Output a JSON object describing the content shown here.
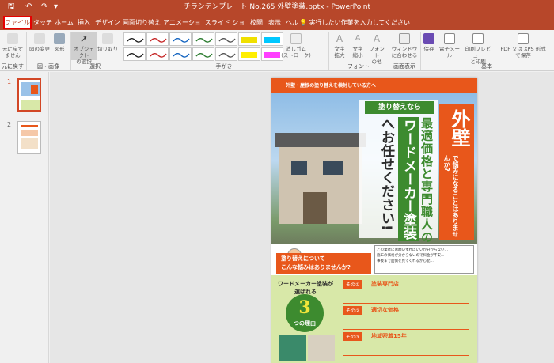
{
  "titlebar": {
    "title": "チラシテンプレート No.265 外壁塗装.pptx - PowerPoint"
  },
  "tabs": [
    {
      "label": "ファイル"
    },
    {
      "label": "タッチ"
    },
    {
      "label": "ホーム"
    },
    {
      "label": "挿入"
    },
    {
      "label": "デザイン"
    },
    {
      "label": "画面切り替え"
    },
    {
      "label": "アニメーション"
    },
    {
      "label": "スライド ショー"
    },
    {
      "label": "校閲"
    },
    {
      "label": "表示"
    },
    {
      "label": "ヘルプ"
    }
  ],
  "tell_me": "実行したい作業を入力してください",
  "ribbon": {
    "undo": "元に戻す\nません",
    "resize": "図の変更",
    "shapes": "図形",
    "object_select": "オブジェクト\nの選択",
    "lasso": "切り取り",
    "eraser": "消しゴム\n(ストローク)",
    "zoom_in": "文字\n拡大",
    "zoom_out": "文字\n縮小",
    "font_other": "フォント\nの他",
    "fit_window": "ウィンドウ\nに合わせる",
    "save": "保存",
    "email": "電子メール",
    "print_preview": "印刷プレビュー\nと印刷",
    "pdf": "PDF 又は XPS 形式\nで保存",
    "groups": {
      "undo": "元に戻す",
      "images": "図・画像",
      "select": "選択",
      "ink": "手がき",
      "font": "フォント",
      "view": "画面表示",
      "basic": "基本"
    }
  },
  "thumbnails": [
    {
      "number": "1"
    },
    {
      "number": "2"
    }
  ],
  "slide": {
    "top_banner": "外壁・屋根の塗り替えを検討している方へ",
    "lead": "塗り替えなら",
    "line_a": "最適価格と専門職人の",
    "line_b": "ワードメーカー塗装",
    "line_c": "へお任せください!",
    "headline": "外壁",
    "subhead": "で悩みになることはありませんか?",
    "worry_1": "塗り替えについて",
    "worry_2": "こんな悩みはありませんか?",
    "checklist": [
      "どの業者にお願いすればいいか分からない…",
      "施工の価格が分からないので料金が不安…",
      "事後まで面倒を見てくれるか心配…"
    ],
    "reasons_title": "ワードメーカー塗装が選ばれる",
    "reasons_number": "3",
    "reasons_suffix": "つの理由",
    "reasons": [
      {
        "tag": "その①",
        "title": "塗装専門店"
      },
      {
        "tag": "その②",
        "title": "適切な価格"
      },
      {
        "tag": "その③",
        "title": "地域密着15年"
      }
    ]
  },
  "colors": {
    "accent": "#b7472a",
    "orange": "#e8571b",
    "green": "#3d8b2f",
    "lime_bg": "#d8e8a8"
  }
}
